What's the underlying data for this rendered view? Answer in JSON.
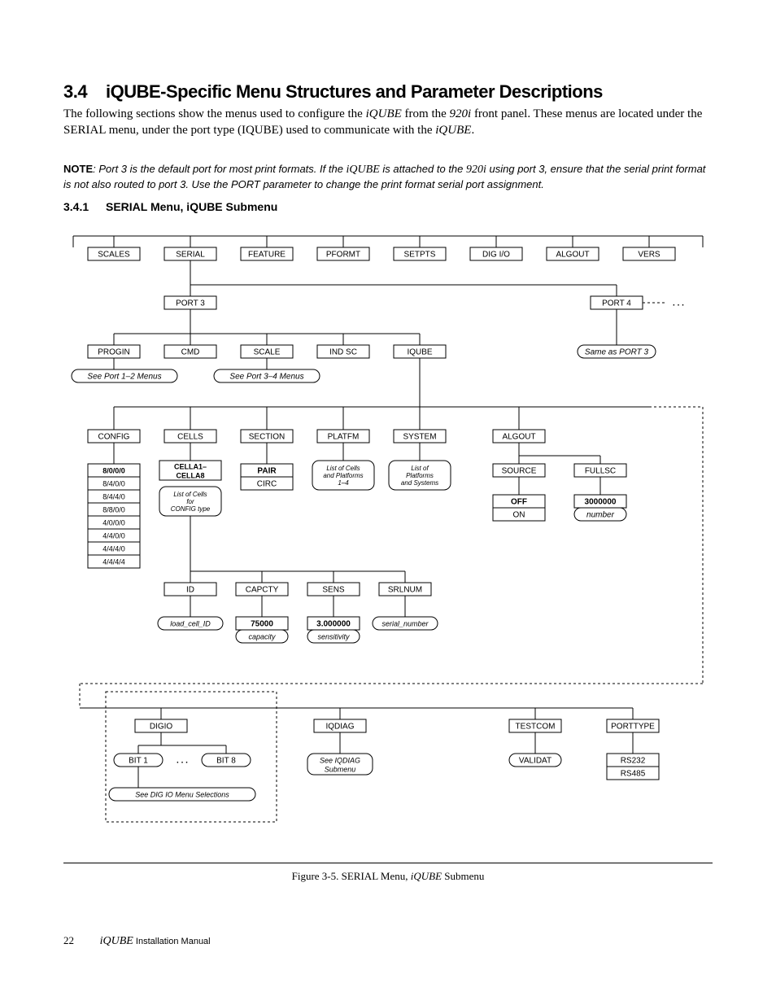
{
  "heading": {
    "num": "3.4",
    "title": "iQUBE-Specific Menu Structures and Parameter Descriptions"
  },
  "intro": {
    "p1a": "The following sections show the menus used to configure the ",
    "p1_iq1": "iQUBE",
    "p1b": " from the ",
    "p1_iq2": "920i",
    "p1c": " front panel. These menus are located under the SERIAL menu, under the port type (IQUBE) used to communicate with the ",
    "p1_iq3": "iQUBE",
    "p1d": "."
  },
  "note": {
    "label": "NOTE",
    "a": ": Port 3 is the default port for most print formats. If the ",
    "iq1": "iQUBE",
    "b": " is attached to the ",
    "iq2": "920i",
    "c": " using port 3, ensure that the serial print format is not also routed to port 3. Use the PORT parameter to change the print format serial port assignment."
  },
  "sub": {
    "num": "3.4.1",
    "title": "SERIAL Menu, iQUBE Submenu"
  },
  "diagram": {
    "row1": [
      "SCALES",
      "SERIAL",
      "FEATURE",
      "PFORMT",
      "SETPTS",
      "DIG I/O",
      "ALGOUT",
      "VERS"
    ],
    "ports": {
      "p3": "PORT 3",
      "p4": "PORT 4",
      "same": "Same as PORT 3",
      "dots": ". . ."
    },
    "row3": [
      "PROGIN",
      "CMD",
      "SCALE",
      "IND SC",
      "IQUBE"
    ],
    "see12": "See Port 1–2 Menus",
    "see34": "See Port 3–4 Menus",
    "row4": [
      "CONFIG",
      "CELLS",
      "SECTION",
      "PLATFM",
      "SYSTEM",
      "ALGOUT"
    ],
    "config_opts": [
      "8/0/0/0",
      "8/4/0/0",
      "8/4/4/0",
      "8/8/0/0",
      "4/0/0/0",
      "4/4/0/0",
      "4/4/4/0",
      "4/4/4/4"
    ],
    "cells": {
      "hdr1": "CELLA1–",
      "hdr2": "CELLA8",
      "note1": "List of Cells",
      "note2": "for",
      "note3": "CONFIG type"
    },
    "section": {
      "hdr": "PAIR",
      "opt": "CIRC"
    },
    "platfm": {
      "l1": "List of Cells",
      "l2": "and Platforms",
      "l3": "1–4"
    },
    "system": {
      "l1": "List of",
      "l2": "Platforms",
      "l3": "and Systems"
    },
    "algout": {
      "source": "SOURCE",
      "fullsc": "FULLSC",
      "off": "OFF",
      "on": "ON",
      "val": "3000000",
      "num": "number"
    },
    "cellsub": {
      "row": [
        "ID",
        "CAPCTY",
        "SENS",
        "SRLNUM"
      ],
      "id": "load_cell_ID",
      "cap": "75000",
      "cap_i": "capacity",
      "sens": "3.000000",
      "sens_i": "sensitivity",
      "srl": "serial_number"
    },
    "bottom": {
      "row": [
        "DIGIO",
        "IQDIAG",
        "TESTCOM",
        "PORTTYPE"
      ],
      "bit1": "BIT 1",
      "bit8": "BIT 8",
      "dots": ". . .",
      "seedig": "See DIG IO Menu Selections",
      "seeiqd1": "See IQDIAG",
      "seeiqd2": "Submenu",
      "validat": "VALIDAT",
      "pt1": "RS232",
      "pt2": "RS485"
    }
  },
  "figure": {
    "pre": "Figure 3-5. SERIAL Menu, ",
    "iq": "iQUBE",
    "post": " Submenu"
  },
  "footer": {
    "page": "22",
    "iq": "iQUBE",
    "man": " Installation Manual"
  }
}
